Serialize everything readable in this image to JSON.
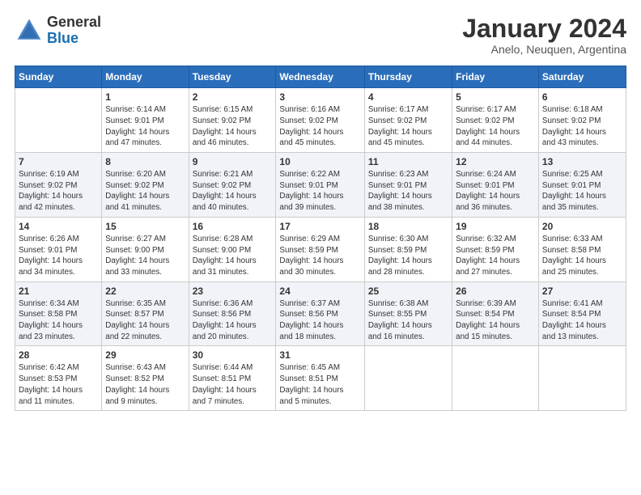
{
  "header": {
    "logo_general": "General",
    "logo_blue": "Blue",
    "month_title": "January 2024",
    "subtitle": "Anelo, Neuquen, Argentina"
  },
  "weekdays": [
    "Sunday",
    "Monday",
    "Tuesday",
    "Wednesday",
    "Thursday",
    "Friday",
    "Saturday"
  ],
  "weeks": [
    [
      {
        "day": "",
        "info": ""
      },
      {
        "day": "1",
        "info": "Sunrise: 6:14 AM\nSunset: 9:01 PM\nDaylight: 14 hours\nand 47 minutes."
      },
      {
        "day": "2",
        "info": "Sunrise: 6:15 AM\nSunset: 9:02 PM\nDaylight: 14 hours\nand 46 minutes."
      },
      {
        "day": "3",
        "info": "Sunrise: 6:16 AM\nSunset: 9:02 PM\nDaylight: 14 hours\nand 45 minutes."
      },
      {
        "day": "4",
        "info": "Sunrise: 6:17 AM\nSunset: 9:02 PM\nDaylight: 14 hours\nand 45 minutes."
      },
      {
        "day": "5",
        "info": "Sunrise: 6:17 AM\nSunset: 9:02 PM\nDaylight: 14 hours\nand 44 minutes."
      },
      {
        "day": "6",
        "info": "Sunrise: 6:18 AM\nSunset: 9:02 PM\nDaylight: 14 hours\nand 43 minutes."
      }
    ],
    [
      {
        "day": "7",
        "info": "Sunrise: 6:19 AM\nSunset: 9:02 PM\nDaylight: 14 hours\nand 42 minutes."
      },
      {
        "day": "8",
        "info": "Sunrise: 6:20 AM\nSunset: 9:02 PM\nDaylight: 14 hours\nand 41 minutes."
      },
      {
        "day": "9",
        "info": "Sunrise: 6:21 AM\nSunset: 9:02 PM\nDaylight: 14 hours\nand 40 minutes."
      },
      {
        "day": "10",
        "info": "Sunrise: 6:22 AM\nSunset: 9:01 PM\nDaylight: 14 hours\nand 39 minutes."
      },
      {
        "day": "11",
        "info": "Sunrise: 6:23 AM\nSunset: 9:01 PM\nDaylight: 14 hours\nand 38 minutes."
      },
      {
        "day": "12",
        "info": "Sunrise: 6:24 AM\nSunset: 9:01 PM\nDaylight: 14 hours\nand 36 minutes."
      },
      {
        "day": "13",
        "info": "Sunrise: 6:25 AM\nSunset: 9:01 PM\nDaylight: 14 hours\nand 35 minutes."
      }
    ],
    [
      {
        "day": "14",
        "info": "Sunrise: 6:26 AM\nSunset: 9:01 PM\nDaylight: 14 hours\nand 34 minutes."
      },
      {
        "day": "15",
        "info": "Sunrise: 6:27 AM\nSunset: 9:00 PM\nDaylight: 14 hours\nand 33 minutes."
      },
      {
        "day": "16",
        "info": "Sunrise: 6:28 AM\nSunset: 9:00 PM\nDaylight: 14 hours\nand 31 minutes."
      },
      {
        "day": "17",
        "info": "Sunrise: 6:29 AM\nSunset: 8:59 PM\nDaylight: 14 hours\nand 30 minutes."
      },
      {
        "day": "18",
        "info": "Sunrise: 6:30 AM\nSunset: 8:59 PM\nDaylight: 14 hours\nand 28 minutes."
      },
      {
        "day": "19",
        "info": "Sunrise: 6:32 AM\nSunset: 8:59 PM\nDaylight: 14 hours\nand 27 minutes."
      },
      {
        "day": "20",
        "info": "Sunrise: 6:33 AM\nSunset: 8:58 PM\nDaylight: 14 hours\nand 25 minutes."
      }
    ],
    [
      {
        "day": "21",
        "info": "Sunrise: 6:34 AM\nSunset: 8:58 PM\nDaylight: 14 hours\nand 23 minutes."
      },
      {
        "day": "22",
        "info": "Sunrise: 6:35 AM\nSunset: 8:57 PM\nDaylight: 14 hours\nand 22 minutes."
      },
      {
        "day": "23",
        "info": "Sunrise: 6:36 AM\nSunset: 8:56 PM\nDaylight: 14 hours\nand 20 minutes."
      },
      {
        "day": "24",
        "info": "Sunrise: 6:37 AM\nSunset: 8:56 PM\nDaylight: 14 hours\nand 18 minutes."
      },
      {
        "day": "25",
        "info": "Sunrise: 6:38 AM\nSunset: 8:55 PM\nDaylight: 14 hours\nand 16 minutes."
      },
      {
        "day": "26",
        "info": "Sunrise: 6:39 AM\nSunset: 8:54 PM\nDaylight: 14 hours\nand 15 minutes."
      },
      {
        "day": "27",
        "info": "Sunrise: 6:41 AM\nSunset: 8:54 PM\nDaylight: 14 hours\nand 13 minutes."
      }
    ],
    [
      {
        "day": "28",
        "info": "Sunrise: 6:42 AM\nSunset: 8:53 PM\nDaylight: 14 hours\nand 11 minutes."
      },
      {
        "day": "29",
        "info": "Sunrise: 6:43 AM\nSunset: 8:52 PM\nDaylight: 14 hours\nand 9 minutes."
      },
      {
        "day": "30",
        "info": "Sunrise: 6:44 AM\nSunset: 8:51 PM\nDaylight: 14 hours\nand 7 minutes."
      },
      {
        "day": "31",
        "info": "Sunrise: 6:45 AM\nSunset: 8:51 PM\nDaylight: 14 hours\nand 5 minutes."
      },
      {
        "day": "",
        "info": ""
      },
      {
        "day": "",
        "info": ""
      },
      {
        "day": "",
        "info": ""
      }
    ]
  ]
}
